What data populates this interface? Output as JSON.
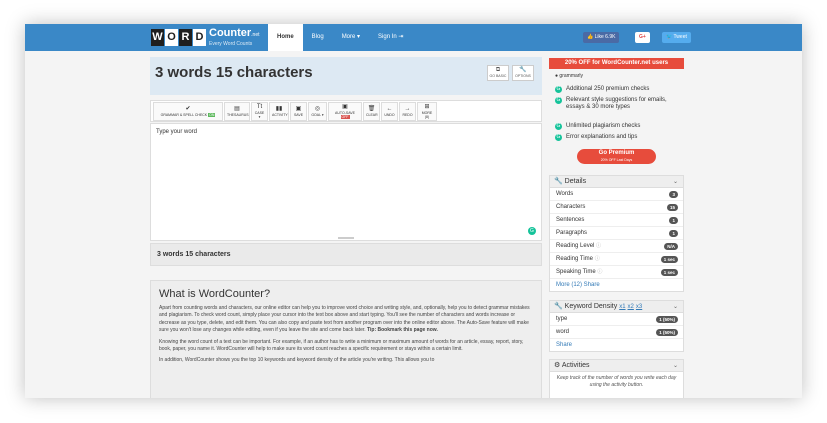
{
  "nav": {
    "logo_letters": [
      "W",
      "O",
      "R",
      "D"
    ],
    "logo_main": "Counter",
    "logo_suffix": ".net",
    "logo_tagline": "Every Word Counts",
    "items": [
      "Home",
      "Blog",
      "More ▾",
      "Sign In ⇥"
    ],
    "fb_like": "👍 Like 6.9K",
    "gplus": "G+",
    "tweet": "🐦 Tweet"
  },
  "editor": {
    "title": "3 words 15 characters",
    "go_basic": "GO BASIC",
    "options": "OPTIONS",
    "toolbar": [
      {
        "icon": "✔",
        "label": "GRAMMAR & SPELL CHECK",
        "badge": "ON"
      },
      {
        "icon": "▤",
        "label": "THESAURUS"
      },
      {
        "icon": "Tt",
        "label": "CASE ▾"
      },
      {
        "icon": "▮▮",
        "label": "ACTIVITY"
      },
      {
        "icon": "▣",
        "label": "SAVE"
      },
      {
        "icon": "◎",
        "label": "GOAL ▾"
      },
      {
        "icon": "▣",
        "label": "AUTO-SAVE",
        "badge": "OFF"
      },
      {
        "icon": "🗑",
        "label": "CLEAR"
      },
      {
        "icon": "←",
        "label": "UNDO"
      },
      {
        "icon": "→",
        "label": "REDO"
      },
      {
        "icon": "⊞",
        "label": "MORE (8)"
      }
    ],
    "content": "Type your word",
    "counter": "3 words 15 characters"
  },
  "article": {
    "heading": "What is WordCounter?",
    "p1": "Apart from counting words and characters, our online editor can help you to improve word choice and writing style, and, optionally, help you to detect grammar mistakes and plagiarism. To check word count, simply place your cursor into the text box above and start typing. You'll see the number of characters and words increase or decrease as you type, delete, and edit them. You can also copy and paste text from another program over into the online editor above. The Auto-Save feature will make sure you won't lose any changes while editing, even if you leave the site and come back later.",
    "p1_tip": "Tip: Bookmark this page now.",
    "p2": "Knowing the word count of a text can be important. For example, if an author has to write a minimum or maximum amount of words for an article, essay, report, story, book, paper, you name it. WordCounter will help to make sure its word count reaches a specific requirement or stays within a certain limit.",
    "p3": "In addition, WordCounter shows you the top 10 keywords and keyword density of the article you're writing. This allows you to"
  },
  "sidebar": {
    "promo": "20% OFF for WordCounter.net users",
    "grammarly": "grammarly",
    "features": [
      "Additional 250 premium checks",
      "Relevant style suggestions for emails, essays & 30 more types",
      "Unlimited plagiarism checks",
      "Error explanations and tips"
    ],
    "premium_btn": "Go Premium",
    "premium_sub": "20% OFF Last Days",
    "details_title": "Details",
    "details": [
      {
        "label": "Words",
        "value": "3"
      },
      {
        "label": "Characters",
        "value": "15"
      },
      {
        "label": "Sentences",
        "value": "1"
      },
      {
        "label": "Paragraphs",
        "value": "1"
      },
      {
        "label": "Reading Level",
        "value": "N/A"
      },
      {
        "label": "Reading Time",
        "value": "1 sec"
      },
      {
        "label": "Speaking Time",
        "value": "1 sec"
      }
    ],
    "details_footer": "More (12)  Share",
    "kd_title": "Keyword Density",
    "kd_links": [
      "x1",
      "x2",
      "x3"
    ],
    "kd_rows": [
      {
        "label": "type",
        "value": "1 (50%)"
      },
      {
        "label": "word",
        "value": "1 (50%)"
      }
    ],
    "kd_footer": "Share",
    "activities_title": "Activities",
    "activities_text": "Keep track of the number of words you write each day using the activity button."
  }
}
